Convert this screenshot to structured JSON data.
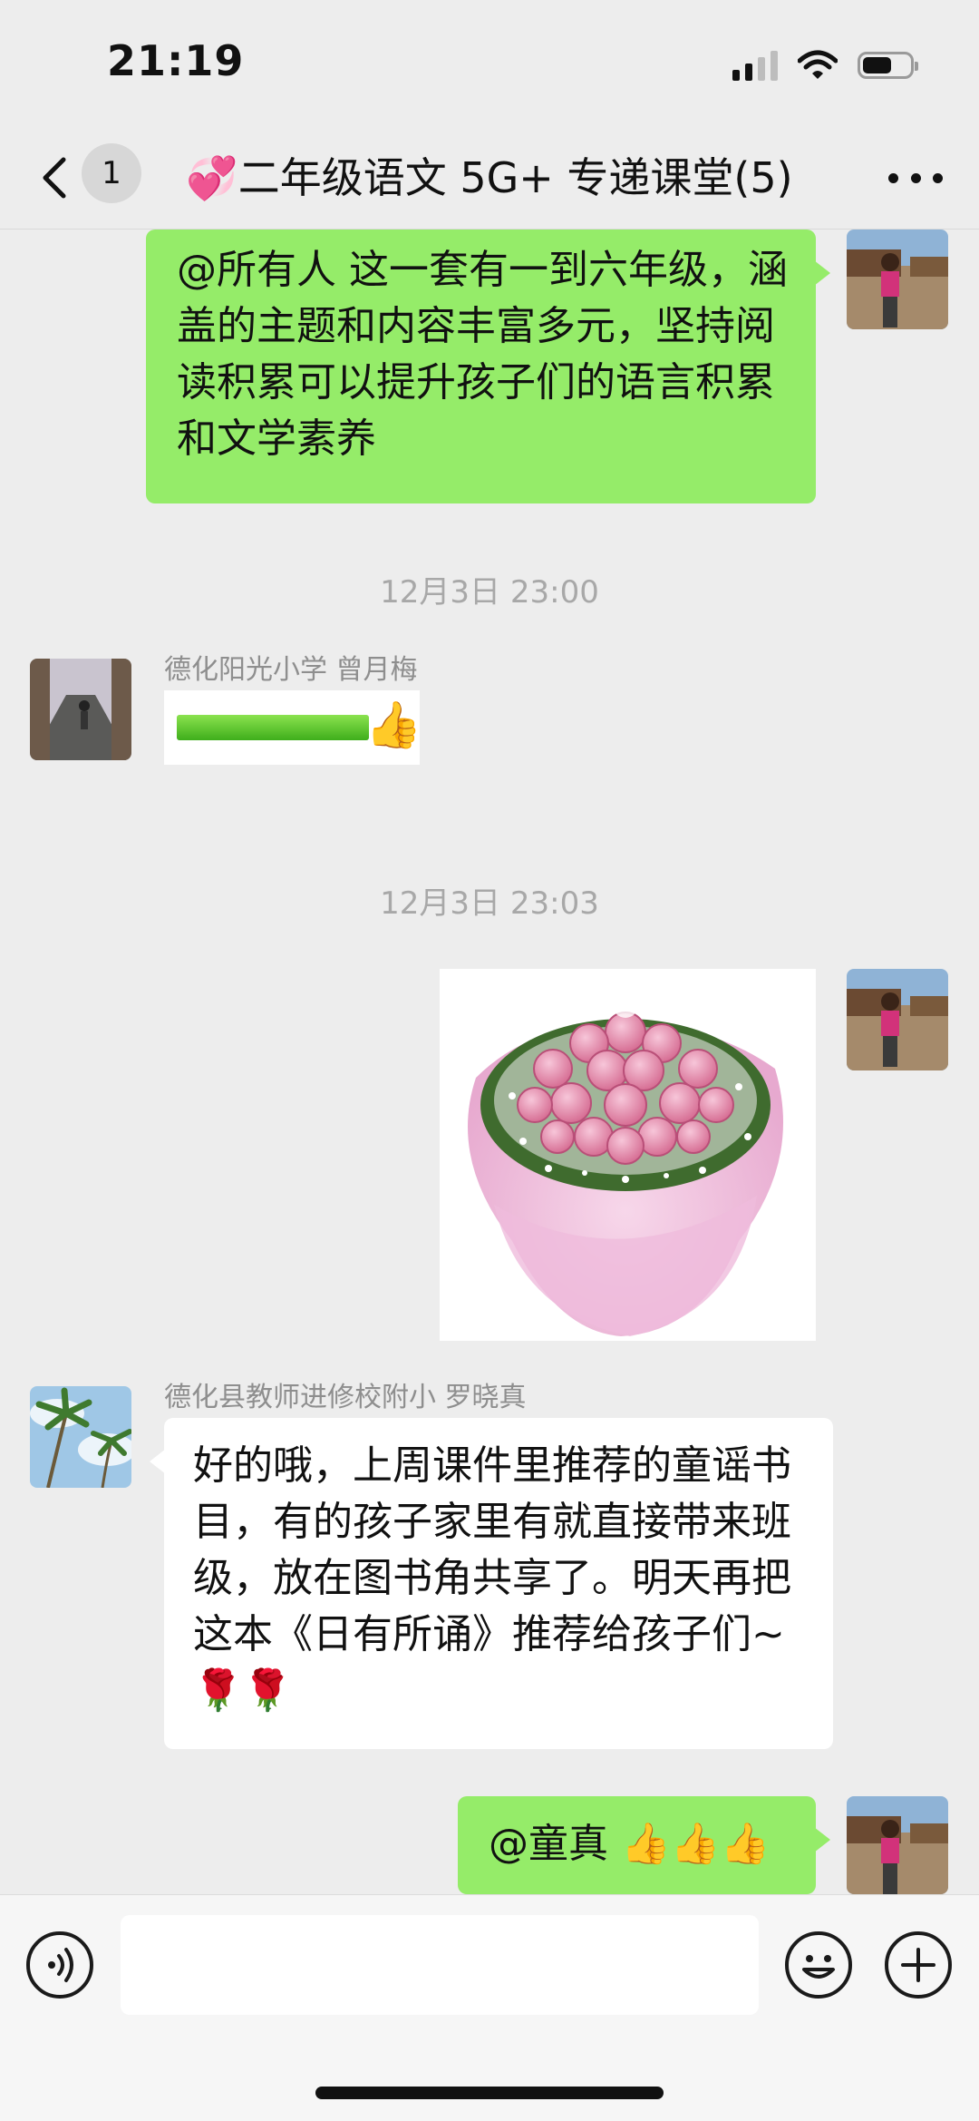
{
  "status_bar": {
    "time": "21:19",
    "battery_level": 0.65
  },
  "nav": {
    "unread_count": "1",
    "title": "💞二年级语文 5G+ 专递课堂(5)"
  },
  "messages": {
    "m1": {
      "text": "@所有人 这一套有一到六年级，涵盖的主题和内容丰富多元，坚持阅读积累可以提升孩子们的语言积累和文学素养"
    },
    "ts1": "12月3日 23:00",
    "m2": {
      "sender": "德化阳光小学 曾月梅",
      "progress_fill": 1.0,
      "emoji": "👍"
    },
    "ts2": "12月3日 23:03",
    "m3": {
      "image": "pink-rose-bouquet"
    },
    "m4": {
      "sender": "德化县教师进修校附小 罗晓真",
      "text": "好的哦，上周课件里推荐的童谣书目，有的孩子家里有就直接带来班级，放在图书角共享了。明天再把这本《日有所诵》推荐给孩子们~🌹🌹"
    },
    "m5": {
      "text": "@童真 👍👍👍"
    }
  },
  "input": {
    "placeholder": ""
  },
  "colors": {
    "my_bubble": "#95ec69",
    "other_bubble": "#ffffff",
    "background": "#ededed",
    "accent": "#07c160"
  }
}
